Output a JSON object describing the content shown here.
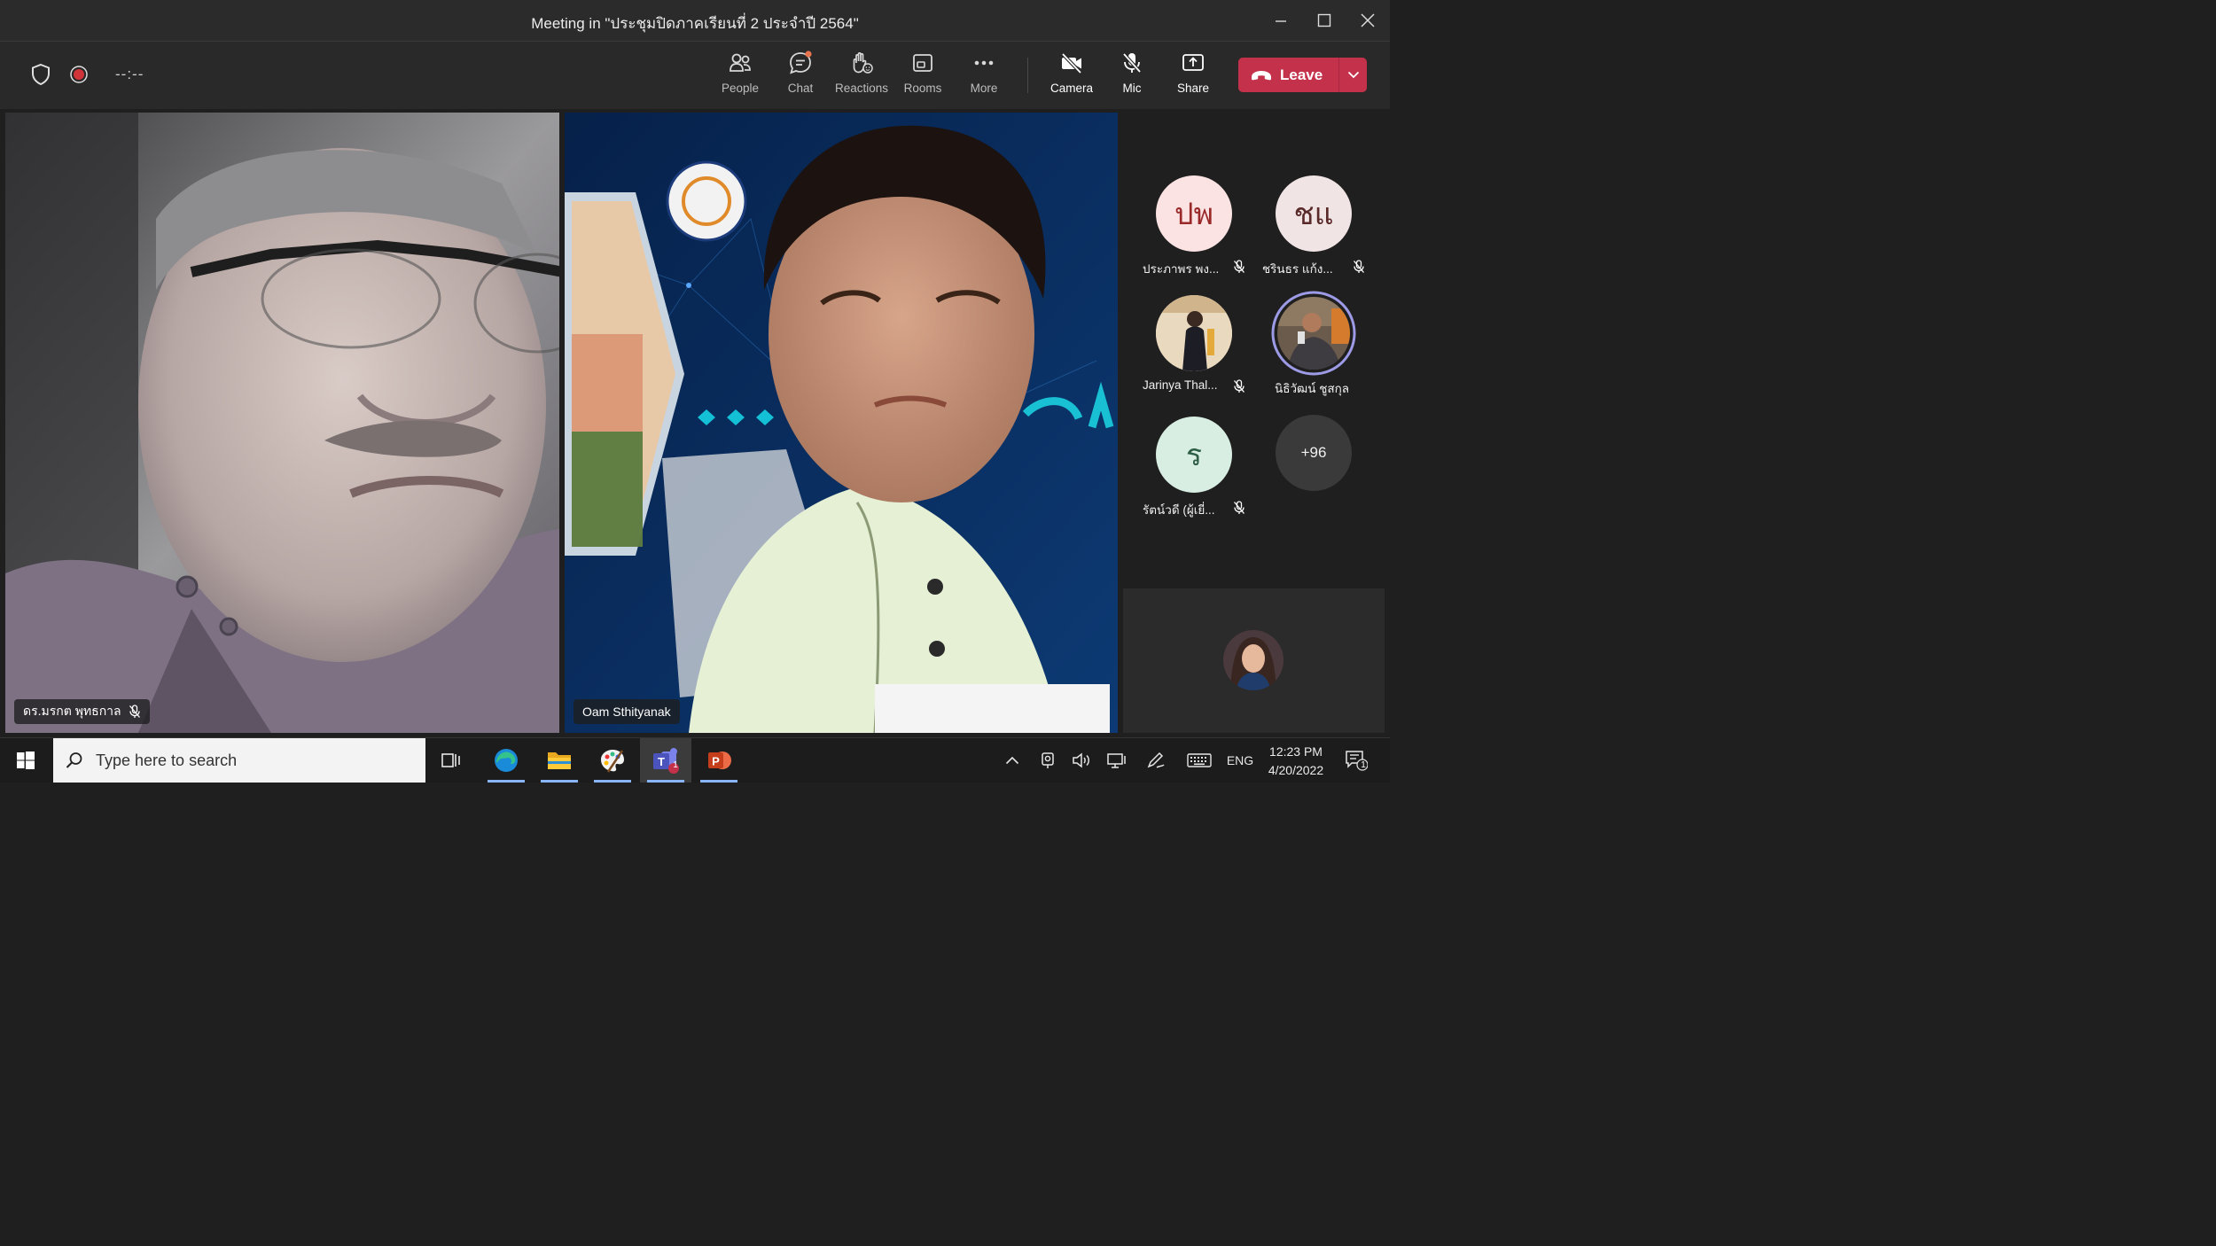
{
  "window": {
    "title": "Meeting in \"ประชุมปิดภาคเรียนที่ 2 ประจำปี 2564\""
  },
  "toolbar": {
    "timer": "--:--",
    "buttons": {
      "people": "People",
      "chat": "Chat",
      "reactions": "Reactions",
      "rooms": "Rooms",
      "more": "More",
      "camera": "Camera",
      "mic": "Mic",
      "share": "Share"
    },
    "leave_label": "Leave"
  },
  "stage": {
    "tile1_name": "ดร.มรกต พุทธกาล",
    "tile2_name": "Oam Sthityanak"
  },
  "roster": {
    "people": [
      {
        "initials": "ปพ",
        "name": "ประภาพร พง...",
        "muted": true,
        "color": "#fbe3e3",
        "text_color": "#9a2a2a"
      },
      {
        "initials": "ชแ",
        "name": "ชรินธร แก้ง...",
        "muted": true,
        "color": "#f1e4e4",
        "text_color": "#5a2a2a"
      },
      {
        "initials": "",
        "name": "Jarinya Thal...",
        "muted": true,
        "color": "#d9c8b0",
        "text_color": "#000000"
      },
      {
        "initials": "",
        "name": "นิธิวัฒน์ ชูสกุล",
        "muted": false,
        "color": "#6a5a4a",
        "text_color": "#000000"
      },
      {
        "initials": "ร",
        "name": "รัตน์วดี (ผู้เยี่...",
        "muted": true,
        "color": "#d8eee3",
        "text_color": "#2e5e45"
      }
    ],
    "more_count": "+96"
  },
  "taskbar": {
    "search_placeholder": "Type here to search",
    "teams_badge": "1",
    "lang": "ENG",
    "time": "12:23 PM",
    "date": "4/20/2022",
    "notifications": "1"
  },
  "colors": {
    "leave": "#c4314b",
    "speaking_ring": "#9d9ae6",
    "chat_dot": "#e8744f"
  }
}
